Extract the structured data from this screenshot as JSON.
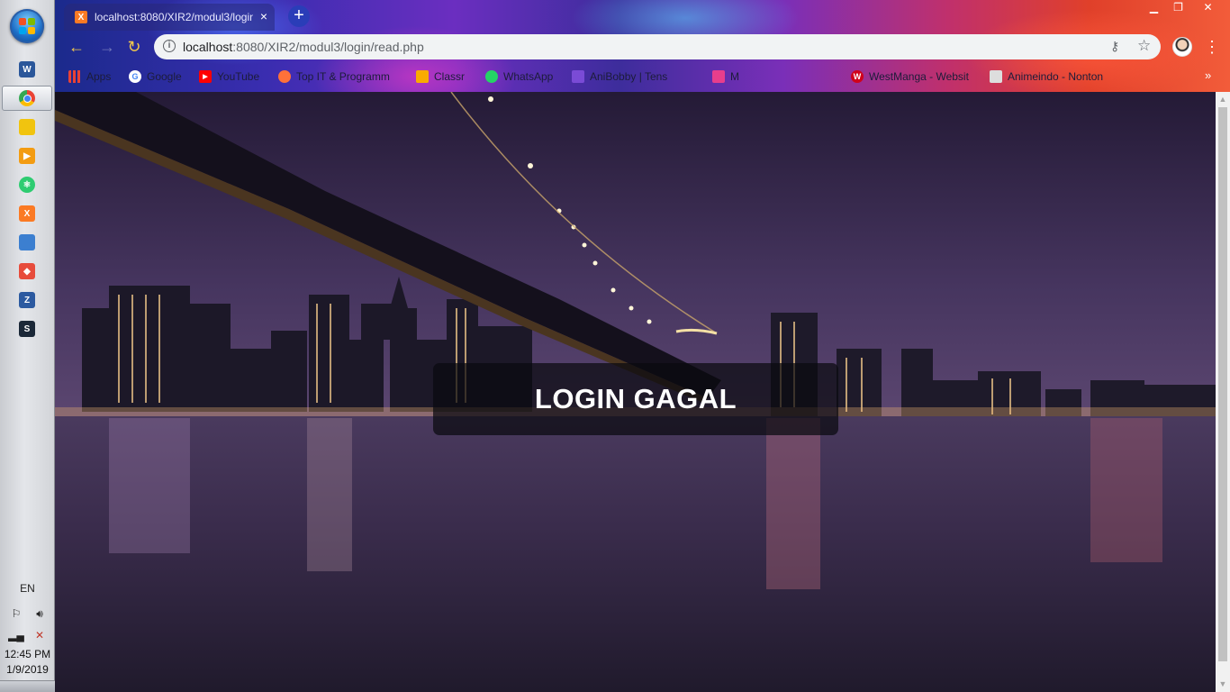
{
  "taskbar": {
    "language": "EN",
    "time": "12:45 PM",
    "date": "1/9/2019",
    "pinned": [
      {
        "name": "word-icon",
        "letter": "W",
        "color": "#2b579a"
      },
      {
        "name": "chrome-icon",
        "letter": "",
        "color": "#4285f4"
      },
      {
        "name": "file-explorer-icon",
        "letter": "",
        "color": "#f1c40f"
      },
      {
        "name": "media-player-icon",
        "letter": "▶",
        "color": "#f39c12"
      },
      {
        "name": "atom-icon",
        "letter": "",
        "color": "#2ecc71"
      },
      {
        "name": "xampp-icon",
        "letter": "X",
        "color": "#fb7a24"
      },
      {
        "name": "virtualbox-icon",
        "letter": "",
        "color": "#3c7fd0"
      },
      {
        "name": "git-icon",
        "letter": "◆",
        "color": "#e74c3c"
      },
      {
        "name": "filezilla-icon",
        "letter": "Z",
        "color": "#2c5aa0"
      },
      {
        "name": "steam-icon",
        "letter": "S",
        "color": "#1b2838"
      }
    ]
  },
  "browser": {
    "tab": {
      "title": "localhost:8080/XIR2/modul3/login",
      "close": "×"
    },
    "new_tab": "+",
    "window_controls": {
      "minimize": "▁",
      "maximize": "❐",
      "close": "✕"
    },
    "address": {
      "host": "localhost",
      "rest": ":8080/XIR2/modul3/login/read.php"
    },
    "bookmarks": [
      {
        "label": "Apps",
        "icon": "apps-icon",
        "color": "#e94235"
      },
      {
        "label": "Google",
        "icon": "google-icon",
        "color": "#4285f4"
      },
      {
        "label": "YouTube",
        "icon": "youtube-icon",
        "color": "#ff0000"
      },
      {
        "label": "Top IT & Programm",
        "icon": "firefox-icon",
        "color": "#ff7139"
      },
      {
        "label": "Classr",
        "icon": "classroom-icon",
        "color": "#f9ab00"
      },
      {
        "label": "WhatsApp",
        "icon": "whatsapp-icon",
        "color": "#25d366"
      },
      {
        "label": "AniBobby | Tens",
        "icon": "bird-icon",
        "color": "#7a4bd6"
      },
      {
        "label": "M",
        "icon": "m-icon",
        "color": "#e83e8c"
      },
      {
        "label": "WestManga - Websit",
        "icon": "westmanga-icon",
        "color": "#d0021b"
      },
      {
        "label": "Animeindo - Nonton",
        "icon": "animeindo-icon",
        "color": "#dddddd"
      }
    ],
    "more_bookmarks": "»"
  },
  "page": {
    "message": "LOGIN GAGAL"
  }
}
